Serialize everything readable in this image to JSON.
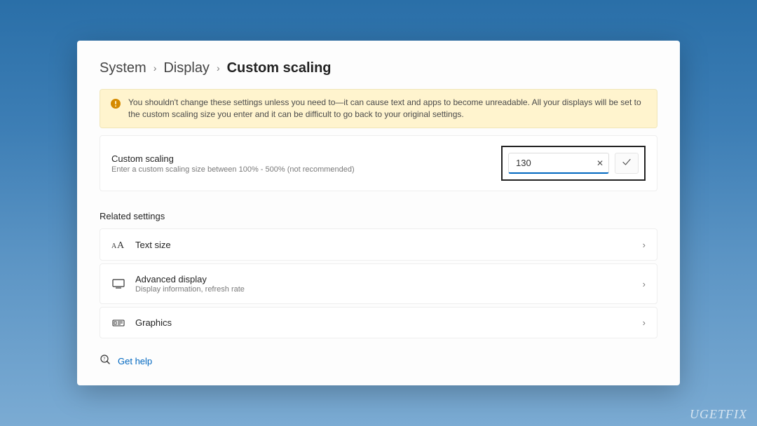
{
  "breadcrumb": {
    "system": "System",
    "display": "Display",
    "current": "Custom scaling"
  },
  "warning": {
    "text": "You shouldn't change these settings unless you need to—it can cause text and apps to become unreadable. All your displays will be set to the custom scaling size you enter and it can be difficult to go back to your original settings."
  },
  "scaling": {
    "title": "Custom scaling",
    "sub": "Enter a custom scaling size between 100% - 500% (not recommended)",
    "value": "130"
  },
  "related": {
    "heading": "Related settings",
    "items": [
      {
        "title": "Text size",
        "sub": ""
      },
      {
        "title": "Advanced display",
        "sub": "Display information, refresh rate"
      },
      {
        "title": "Graphics",
        "sub": ""
      }
    ]
  },
  "help": {
    "label": "Get help"
  },
  "watermark": "UGETFIX"
}
